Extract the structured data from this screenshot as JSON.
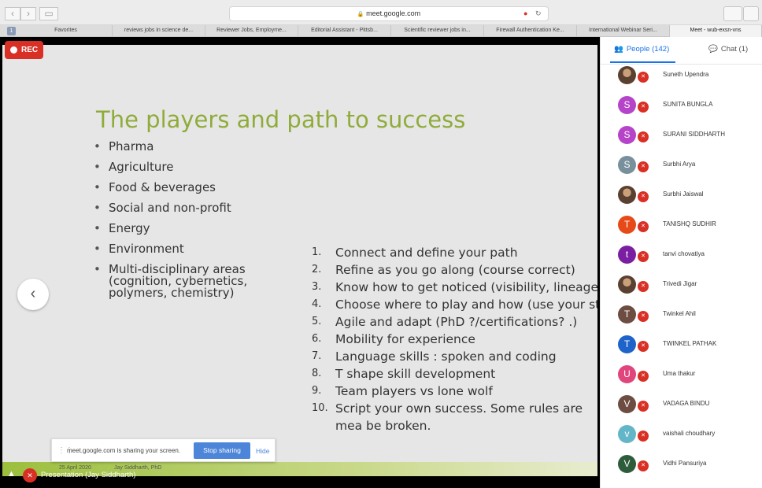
{
  "browser": {
    "url": "meet.google.com",
    "tab_number": "1",
    "tabs": [
      "Favorites",
      "reviews jobs in science de...",
      "Reviewer Jobs, Employme...",
      "Editorial Assistant - Pittsb...",
      "Scientific reviewer jobs in...",
      "Firewall Authentication Ke...",
      "International Webinar Seri...",
      "Meet - wub-exsn-vns"
    ]
  },
  "meet": {
    "rec_label": "REC",
    "share_bar": {
      "text": "meet.google.com is sharing your screen.",
      "stop_label": "Stop sharing",
      "hide_label": "Hide"
    },
    "presenter_label": "Presentation (Jay Siddharth)"
  },
  "slide": {
    "title": "The players and path to success",
    "bullets": [
      "Pharma",
      "Agriculture",
      "Food & beverages",
      "Social and non-profit",
      "Energy",
      "Environment",
      "Multi-disciplinary areas\n(cognition, cybernetics,\npolymers, chemistry)"
    ],
    "steps": [
      {
        "n": "1.",
        "t": "Connect and define your path"
      },
      {
        "n": "2.",
        "t": "Refine as you go along (course correct)"
      },
      {
        "n": "3.",
        "t": "Know how to get noticed (visibility, lineage, e"
      },
      {
        "n": "4.",
        "t": "Choose where to play and how (use your stre"
      },
      {
        "n": "5.",
        "t": "Agile and adapt (PhD ?/certifications? .)"
      },
      {
        "n": "6.",
        "t": "Mobility for experience"
      },
      {
        "n": "7.",
        "t": "Language skills : spoken and coding"
      },
      {
        "n": "8.",
        "t": "T shape skill development"
      },
      {
        "n": "9.",
        "t": "Team players vs lone wolf"
      },
      {
        "n": "10.",
        "t": "Script your own success. Some rules are mea be broken."
      }
    ],
    "footer_left": "25 April 2020",
    "footer_right": "Jay Siddharth, PhD"
  },
  "panel": {
    "people_tab": "People (142)",
    "chat_tab": "Chat (1)",
    "participants": [
      {
        "initial": "",
        "name": "Suneth Upendra",
        "color": "#5a4030",
        "photo": true
      },
      {
        "initial": "S",
        "name": "SUNITA BUNGLA",
        "color": "#b544c8"
      },
      {
        "initial": "S",
        "name": "SURANI SIDDHARTH",
        "color": "#b544c8"
      },
      {
        "initial": "S",
        "name": "Surbhi Arya",
        "color": "#78909c"
      },
      {
        "initial": "",
        "name": "Surbhi Jaiswal",
        "color": "#8a7a6a",
        "photo": true
      },
      {
        "initial": "T",
        "name": "TANISHQ SUDHIR",
        "color": "#e64a19"
      },
      {
        "initial": "t",
        "name": "tanvi chovatiya",
        "color": "#7b1fa2"
      },
      {
        "initial": "",
        "name": "Trivedi Jigar",
        "color": "#c0602a",
        "photo": true
      },
      {
        "initial": "T",
        "name": "Twinkel Ahil",
        "color": "#6d4c41"
      },
      {
        "initial": "T",
        "name": "TWINKEL PATHAK",
        "color": "#1e63c9"
      },
      {
        "initial": "U",
        "name": "Uma thakur",
        "color": "#e0457b"
      },
      {
        "initial": "V",
        "name": "VADAGA BINDU",
        "color": "#6d4c41"
      },
      {
        "initial": "v",
        "name": "vaishali choudhary",
        "color": "#63b6c8"
      },
      {
        "initial": "V",
        "name": "Vidhi Pansuriya",
        "color": "#2e5b3a"
      }
    ]
  }
}
